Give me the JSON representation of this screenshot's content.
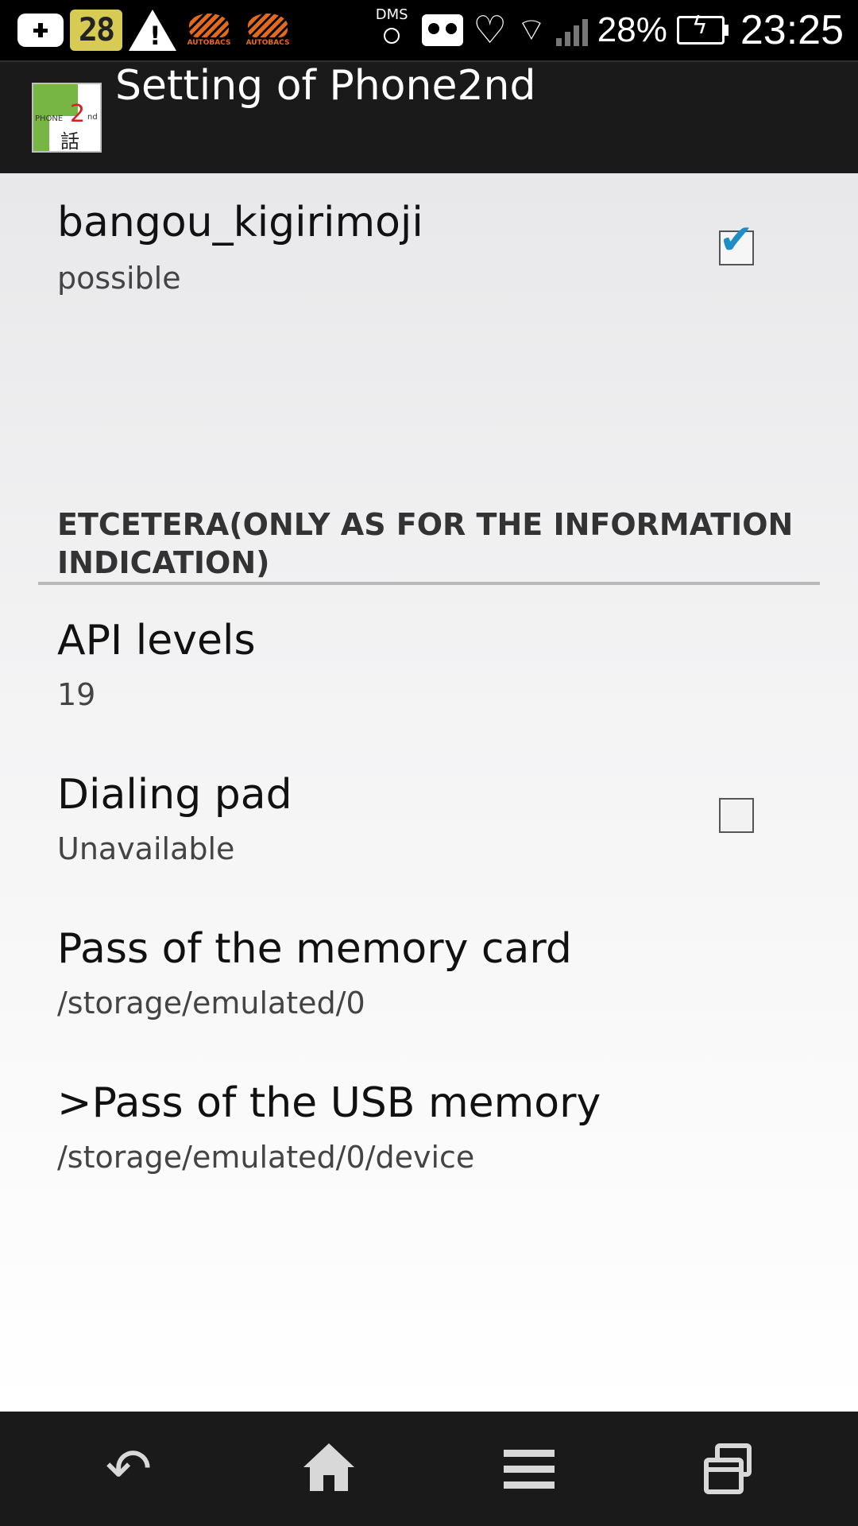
{
  "status_bar": {
    "calendar_day": "28",
    "dms_label": "DMS",
    "autobacs_label": "AUTOBACS",
    "battery_percent": "28%",
    "clock": "23:25",
    "icons": [
      "plus-icon",
      "calendar-icon",
      "warning-icon",
      "autobacs-icon",
      "autobacs-icon",
      "dms-icon",
      "voicemail-icon",
      "heart-icon",
      "wifi-icon",
      "signal-icon",
      "battery-charging-icon"
    ]
  },
  "action_bar": {
    "title": "Setting of Phone2nd",
    "app_icon": {
      "phone_text": "PHONE",
      "number": "2",
      "suffix": "nd",
      "kanji": "話"
    }
  },
  "preferences": {
    "bangou": {
      "title": "bangou_kigirimoji",
      "summary": "possible",
      "checked": true
    },
    "category": {
      "title": "ETCETERA(ONLY AS FOR THE INFORMATION INDICATION)"
    },
    "api_levels": {
      "title": "API levels",
      "summary": "19"
    },
    "dialing_pad": {
      "title": "Dialing pad",
      "summary": "Unavailable",
      "checked": false
    },
    "memory_card": {
      "title": "Pass of the memory card",
      "summary": "/storage/emulated/0"
    },
    "usb_memory": {
      "title": ">Pass of the USB memory",
      "summary": "/storage/emulated/0/device"
    }
  },
  "nav_bar": {
    "buttons": [
      "back-icon",
      "home-icon",
      "menu-icon",
      "recents-icon"
    ]
  },
  "colors": {
    "checkmark": "#1e8fc6",
    "action_bar_bg": "#1a1a1a",
    "app_icon_green": "#77b544",
    "app_icon_red": "#d32222"
  }
}
